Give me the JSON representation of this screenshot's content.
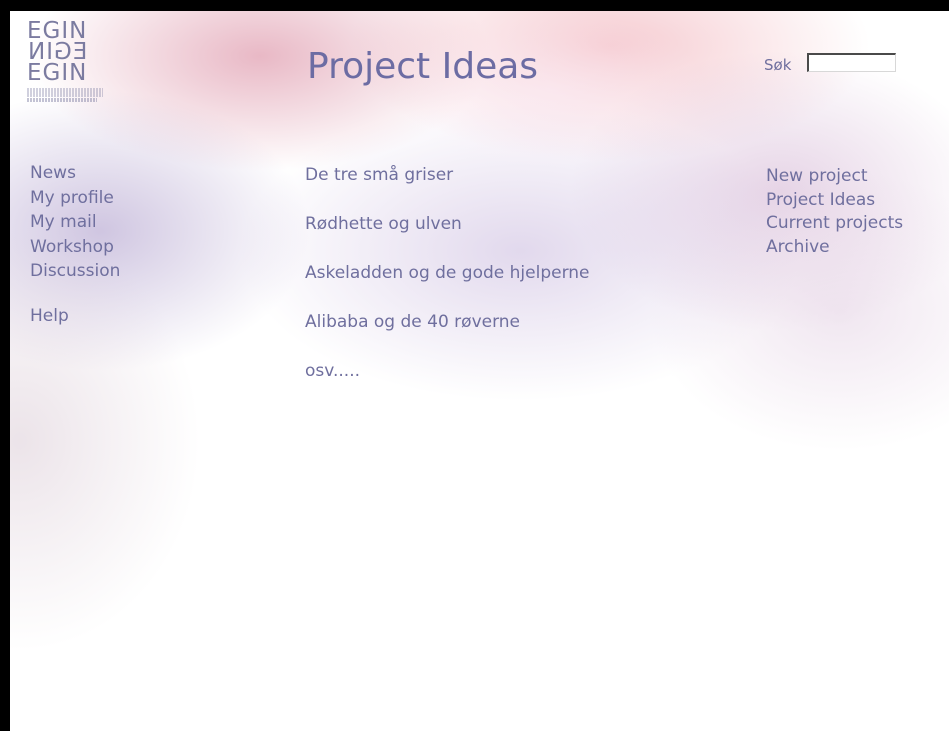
{
  "logo": {
    "lines": [
      "EGIN",
      "EGIN",
      "EGIN"
    ],
    "icon": "egin-logo"
  },
  "header": {
    "title": "Project Ideas"
  },
  "search": {
    "label": "Søk",
    "value": "",
    "placeholder": ""
  },
  "left_nav": {
    "items": [
      {
        "label": "News"
      },
      {
        "label": "My profile"
      },
      {
        "label": "My mail"
      },
      {
        "label": "Workshop"
      },
      {
        "label": "Discussion"
      }
    ],
    "help": {
      "label": "Help"
    }
  },
  "main": {
    "ideas": [
      {
        "label": "De tre små griser"
      },
      {
        "label": "Rødhette og ulven"
      },
      {
        "label": "Askeladden og de gode hjelperne"
      },
      {
        "label": "Alibaba og de 40 røverne"
      }
    ],
    "more_text": "osv....."
  },
  "right_nav": {
    "items": [
      {
        "label": "New project"
      },
      {
        "label": "Project Ideas"
      },
      {
        "label": "Current projects"
      },
      {
        "label": "Archive"
      }
    ]
  },
  "colors": {
    "text": "#6f6f9e",
    "title": "#6c6ca3",
    "frame": "#000000"
  }
}
